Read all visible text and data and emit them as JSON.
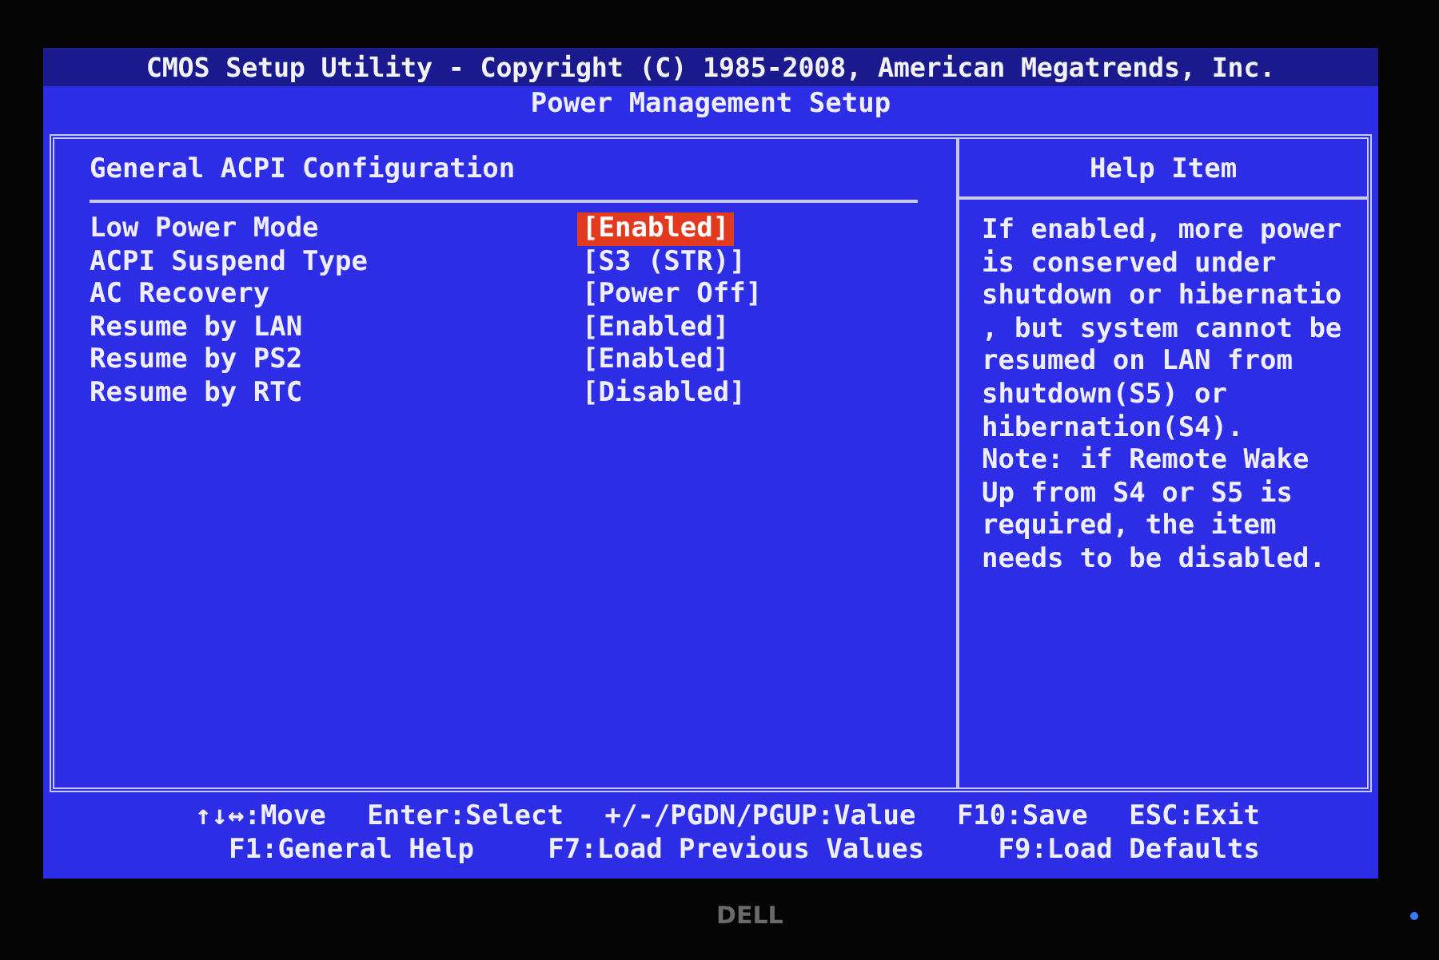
{
  "header": {
    "title": "CMOS Setup Utility - Copyright (C) 1985-2008, American Megatrends, Inc.",
    "subtitle": "Power Management Setup"
  },
  "section": {
    "title": "General ACPI Configuration",
    "items": [
      {
        "label": "Low Power Mode",
        "value": "[Enabled]",
        "selected": true
      },
      {
        "label": "ACPI Suspend Type",
        "value": "[S3 (STR)]",
        "selected": false
      },
      {
        "label": "AC Recovery",
        "value": "[Power Off]",
        "selected": false
      },
      {
        "label": "Resume by LAN",
        "value": "[Enabled]",
        "selected": false
      },
      {
        "label": "Resume by PS2",
        "value": "[Enabled]",
        "selected": false
      },
      {
        "label": "Resume by RTC",
        "value": "[Disabled]",
        "selected": false
      }
    ]
  },
  "help": {
    "title": "Help Item",
    "lines": [
      "If enabled, more power",
      "is conserved under",
      "shutdown or hibernatio",
      ", but system cannot be",
      "resumed on LAN from",
      "shutdown(S5) or",
      "hibernation(S4).",
      "Note: if Remote Wake",
      "Up from S4 or S5 is",
      "required, the item",
      "needs to be disabled."
    ]
  },
  "footer": [
    [
      "↑↓↔:Move",
      "Enter:Select",
      "+/-/PGDN/PGUP:Value",
      "F10:Save",
      "ESC:Exit"
    ],
    [
      "F1:General Help",
      "F7:Load Previous Values",
      "F9:Load Defaults"
    ]
  ],
  "bezel": {
    "logo": "DELL"
  }
}
